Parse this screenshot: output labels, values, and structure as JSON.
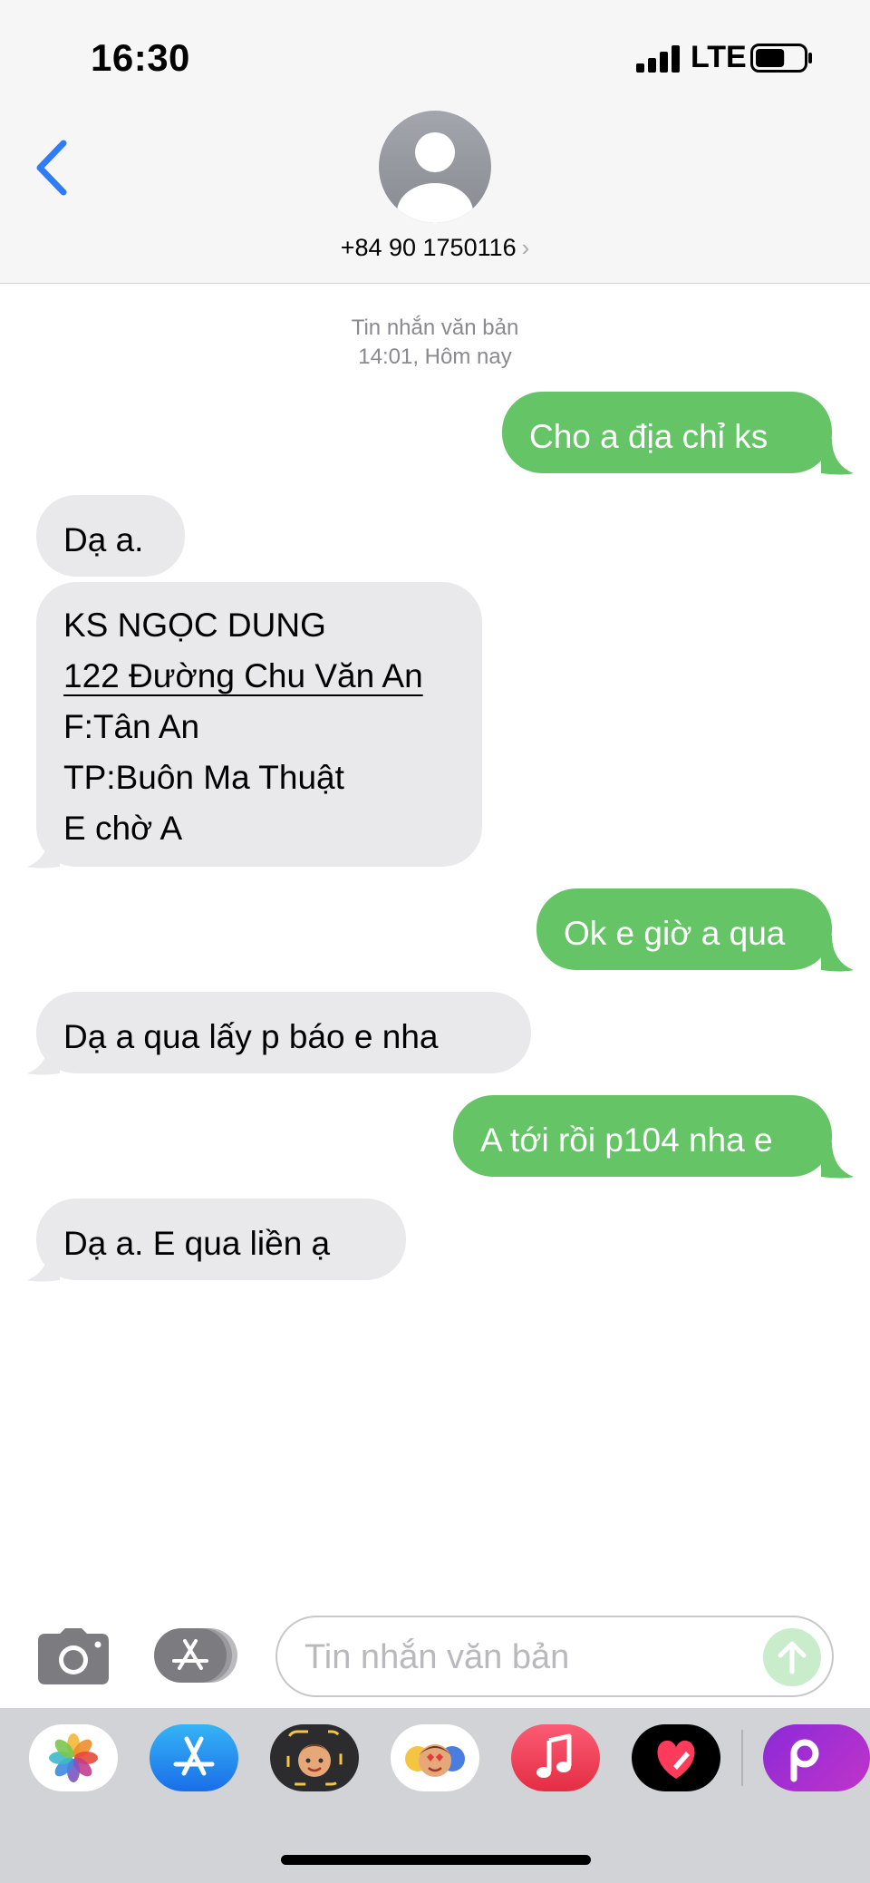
{
  "status_bar": {
    "time": "16:30",
    "network": "LTE",
    "signal_bars": 4,
    "battery_level": 0.6
  },
  "header": {
    "contact": "+84 90 1750116"
  },
  "conversation": {
    "type_label": "Tin nhắn văn bản",
    "timestamp": "14:01, Hôm nay",
    "messages": [
      {
        "direction": "out",
        "lines": [
          "Cho a địa chỉ ks"
        ]
      },
      {
        "direction": "in",
        "lines": [
          "Dạ a."
        ]
      },
      {
        "direction": "in",
        "lines": [
          "KS NGỌC DUNG",
          "122 Đường Chu Văn An",
          "F:Tân An",
          "TP:Buôn Ma Thuật",
          "E chờ A"
        ]
      },
      {
        "direction": "out",
        "lines": [
          "Ok e giờ a qua"
        ]
      },
      {
        "direction": "in",
        "lines": [
          "Dạ  a qua  lấy p  báo e nha"
        ]
      },
      {
        "direction": "out",
        "lines": [
          "A tới rồi p104 nha e"
        ]
      },
      {
        "direction": "in",
        "lines": [
          "Dạ  a. E qua  liền  ạ"
        ]
      }
    ]
  },
  "compose": {
    "placeholder": "Tin nhắn văn bản",
    "value": ""
  },
  "app_drawer": {
    "apps": [
      "photos-app",
      "app-store-app",
      "memoji-app",
      "animoji-stickers-app",
      "music-app",
      "digital-touch-app",
      "picsart-app"
    ]
  },
  "colors": {
    "outgoing": "#65c466",
    "incoming": "#e9e9eb",
    "accent": "#2f7cf6",
    "meta_text": "#8a8a8e"
  }
}
